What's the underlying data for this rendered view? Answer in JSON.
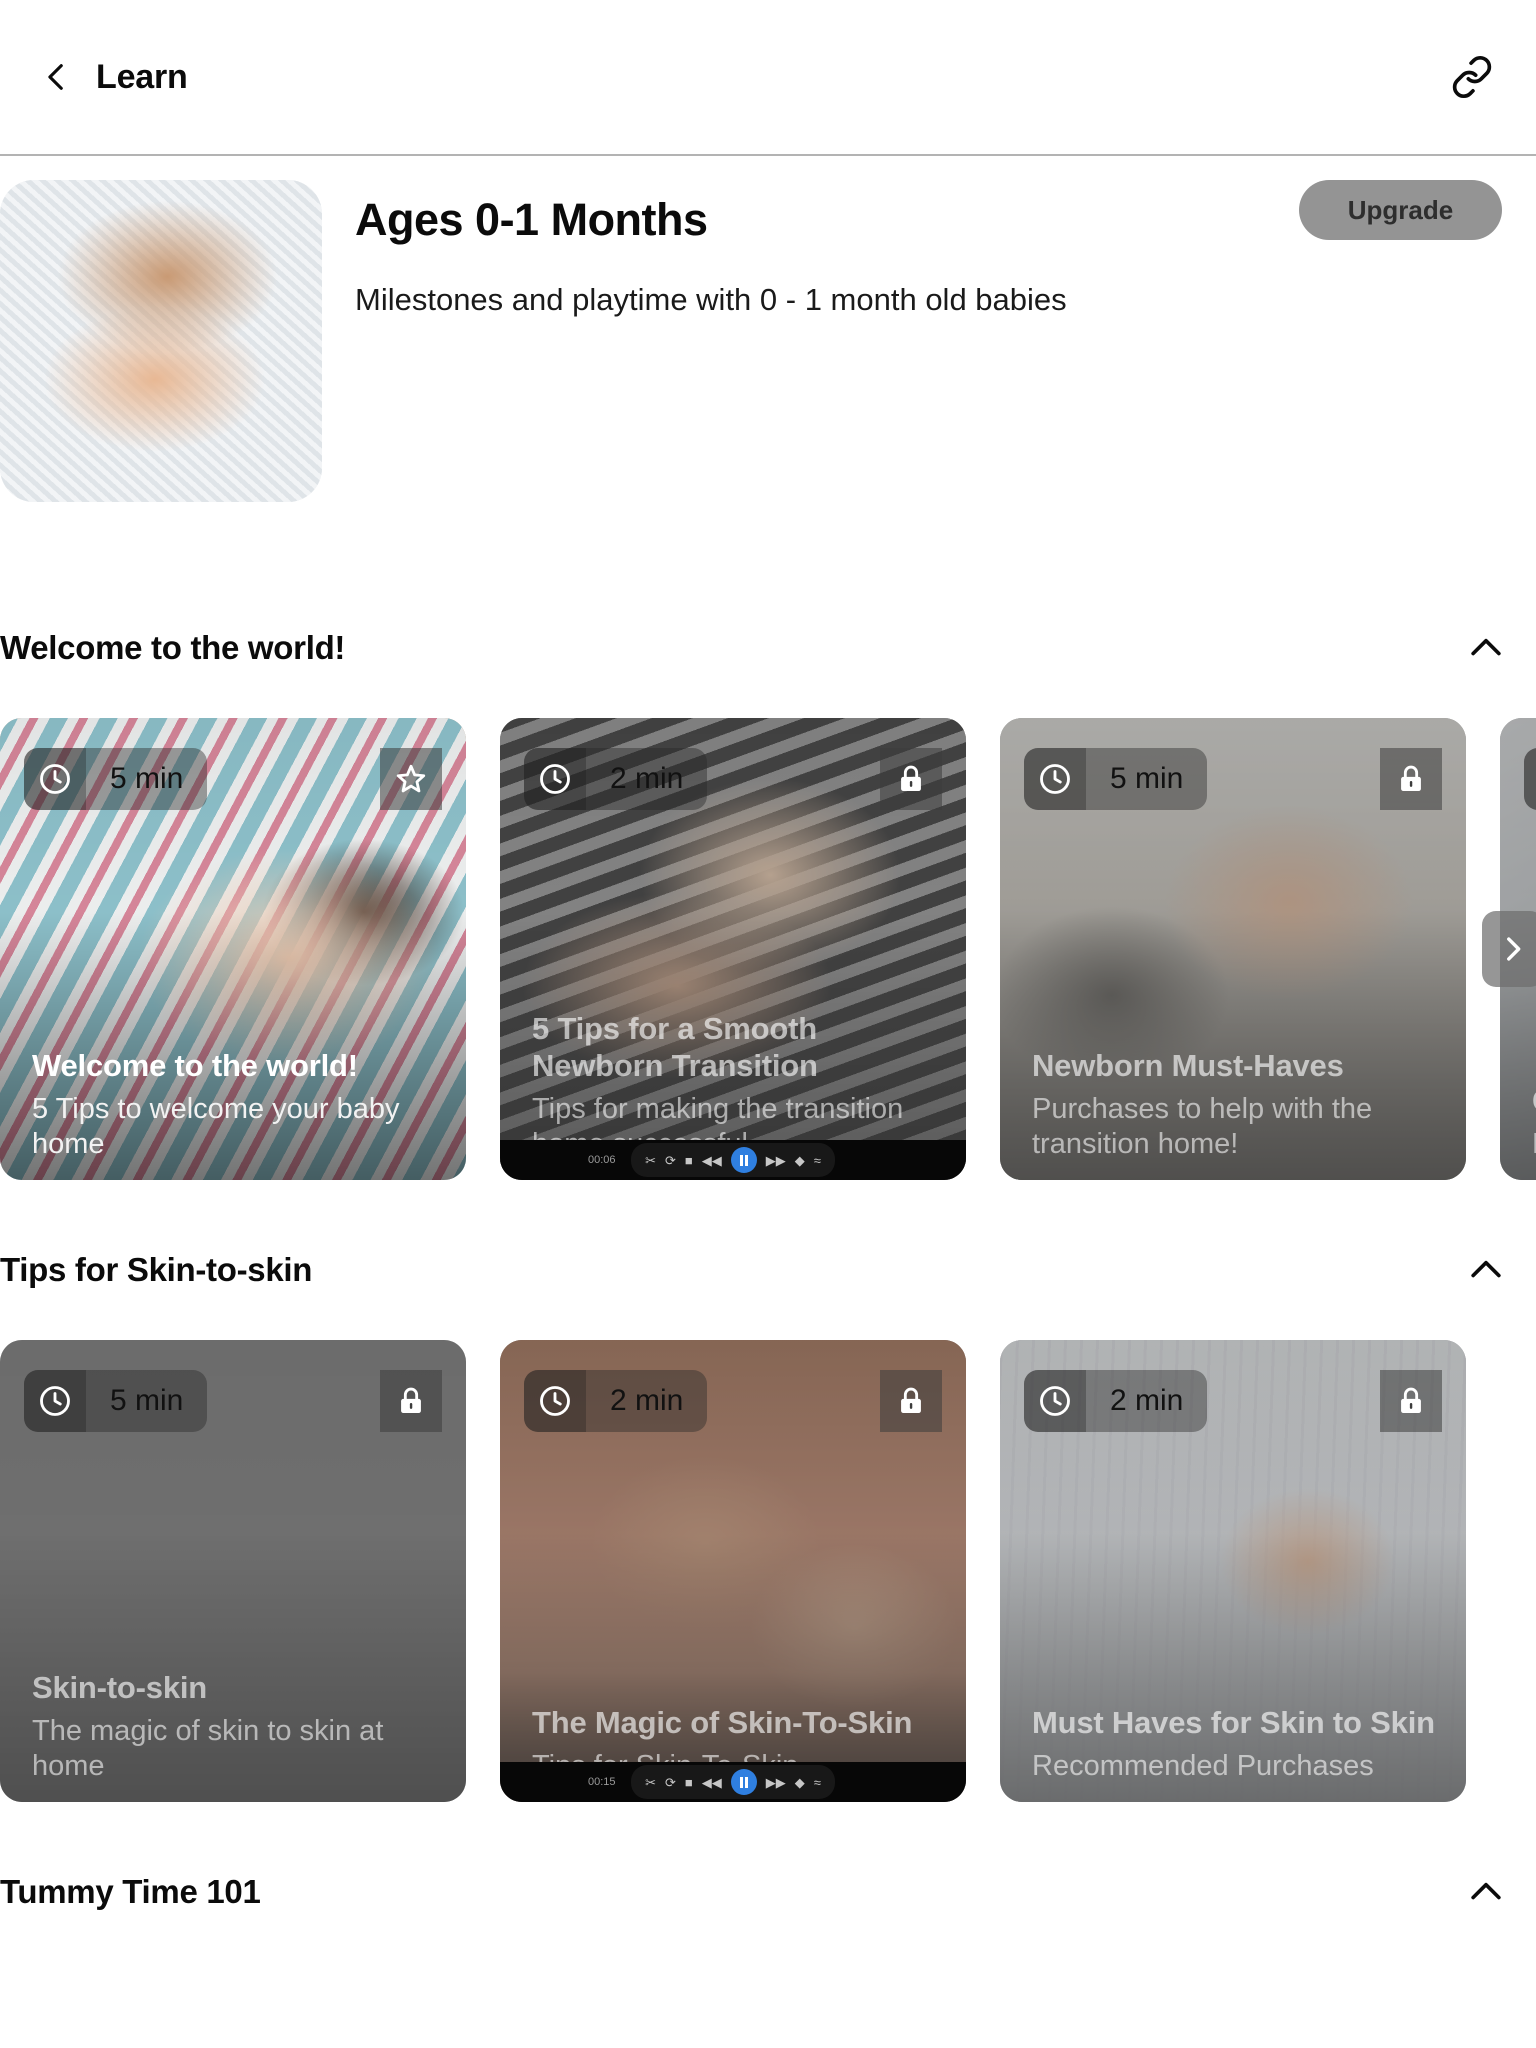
{
  "nav": {
    "back_icon": "chevron-left-icon",
    "title": "Learn",
    "share_icon": "link-icon"
  },
  "hero": {
    "title": "Ages 0-1 Months",
    "subtitle": "Milestones and playtime with 0 - 1 month old babies",
    "upgrade_label": "Upgrade",
    "thumbnail_alt": "sleeping-newborn-photo",
    "upgrade_bg": "#949494"
  },
  "sections": [
    {
      "title": "Welcome to the world!",
      "collapse_icon": "chevron-up-icon",
      "has_next_arrow": true,
      "next_arrow_icon": "chevron-right-icon",
      "cards": [
        {
          "duration": "5 min",
          "clock_icon": "clock-icon",
          "corner_icon": "star-icon",
          "locked": false,
          "has_video_bar": false,
          "title": "Welcome to the world!",
          "subtitle": "5 Tips to welcome your baby home",
          "photo_class": "ph-c1"
        },
        {
          "duration": "2 min",
          "clock_icon": "clock-icon",
          "corner_icon": "lock-icon",
          "locked": true,
          "has_video_bar": true,
          "video_time": "00:06",
          "title": "5 Tips for a Smooth Newborn Transition",
          "subtitle": "Tips for making the transition home successful",
          "photo_class": "ph-c2"
        },
        {
          "duration": "5 min",
          "clock_icon": "clock-icon",
          "corner_icon": "lock-icon",
          "locked": true,
          "has_video_bar": false,
          "title": "Newborn Must-Haves",
          "subtitle": "Purchases to help with the transition home!",
          "photo_class": "ph-c3"
        },
        {
          "duration": "",
          "clock_icon": "clock-icon",
          "corner_icon": "lock-icon",
          "locked": true,
          "has_video_bar": false,
          "title": "C",
          "subtitle": "B s",
          "photo_class": "ph-c4"
        }
      ]
    },
    {
      "title": "Tips for Skin-to-skin",
      "collapse_icon": "chevron-up-icon",
      "has_next_arrow": false,
      "next_arrow_icon": "chevron-right-icon",
      "cards": [
        {
          "duration": "5 min",
          "clock_icon": "clock-icon",
          "corner_icon": "lock-icon",
          "locked": true,
          "has_video_bar": false,
          "title": "Skin-to-skin",
          "subtitle": "The magic of skin to skin at home",
          "photo_class": "ph-d1"
        },
        {
          "duration": "2 min",
          "clock_icon": "clock-icon",
          "corner_icon": "lock-icon",
          "locked": true,
          "has_video_bar": true,
          "video_time": "00:15",
          "title": "The Magic of Skin-To-Skin",
          "subtitle": "Tips for Skin-To-Skin",
          "photo_class": "ph-d2"
        },
        {
          "duration": "2 min",
          "clock_icon": "clock-icon",
          "corner_icon": "lock-icon",
          "locked": true,
          "has_video_bar": false,
          "title": "Must Haves for Skin to Skin",
          "subtitle": "Recommended Purchases",
          "photo_class": "ph-d3"
        }
      ]
    },
    {
      "title": "Tummy Time 101",
      "collapse_icon": "chevron-up-icon",
      "has_next_arrow": false,
      "next_arrow_icon": "chevron-right-icon",
      "cards": []
    }
  ]
}
